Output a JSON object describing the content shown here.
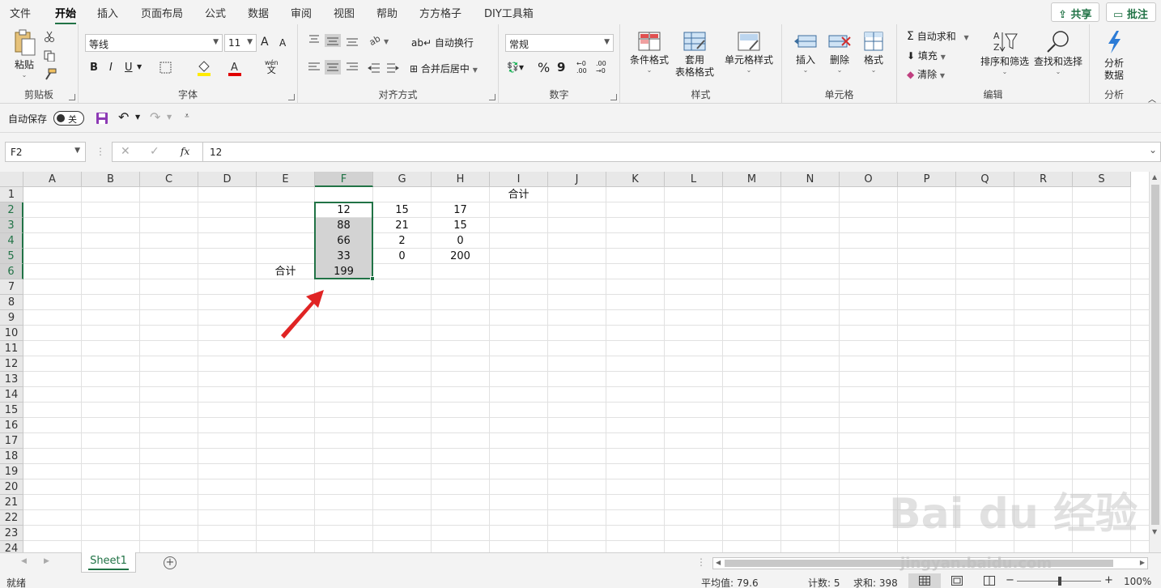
{
  "menu": {
    "tabs": [
      "文件",
      "开始",
      "插入",
      "页面布局",
      "公式",
      "数据",
      "审阅",
      "视图",
      "帮助",
      "方方格子",
      "DIY工具箱"
    ],
    "share": "共享",
    "comment": "批注"
  },
  "ribbon": {
    "clipboard": {
      "label": "剪贴板",
      "paste": "粘贴"
    },
    "font": {
      "label": "字体",
      "name": "等线",
      "size": "11",
      "grow": "A",
      "shrink": "A",
      "bold": "B",
      "italic": "I",
      "underline": "U",
      "phonetic_top": "wén",
      "phonetic_bottom": "文"
    },
    "align": {
      "label": "对齐方式",
      "wrap": "自动换行",
      "merge": "合并后居中"
    },
    "number": {
      "label": "数字",
      "format": "常规",
      "percent": "%",
      "comma": "9",
      "inc": "←0 .00",
      "dec": ".00 →0"
    },
    "styles": {
      "label": "样式",
      "conditional": "条件格式",
      "table_line1": "套用",
      "table_line2": "表格格式",
      "cell_styles": "单元格样式"
    },
    "cells": {
      "label": "单元格",
      "insert": "插入",
      "delete": "删除",
      "format": "格式"
    },
    "edit": {
      "label": "编辑",
      "autosum": "自动求和",
      "fill": "填充",
      "clear": "清除",
      "sort": "排序和筛选",
      "find": "查找和选择"
    },
    "analysis": {
      "label": "分析",
      "btn_line1": "分析",
      "btn_line2": "数据"
    }
  },
  "qat": {
    "autosave": "自动保存",
    "toggle": "关"
  },
  "formula_bar": {
    "name_box": "F2",
    "fx": "fx",
    "value": "12"
  },
  "sheet": {
    "columns": [
      "A",
      "B",
      "C",
      "D",
      "E",
      "F",
      "G",
      "H",
      "I",
      "J",
      "K",
      "L",
      "M",
      "N",
      "O",
      "P",
      "Q",
      "R",
      "S"
    ],
    "rows": [
      "1",
      "2",
      "3",
      "4",
      "5",
      "6",
      "7",
      "8",
      "9",
      "10",
      "11",
      "12",
      "13",
      "14",
      "15",
      "16",
      "17",
      "18",
      "19",
      "20",
      "21",
      "22",
      "23",
      "24"
    ],
    "cells": {
      "I1": "合计",
      "F2": "12",
      "G2": "15",
      "H2": "17",
      "F3": "88",
      "G3": "21",
      "H3": "15",
      "F4": "66",
      "G4": "2",
      "H4": "0",
      "F5": "33",
      "G5": "0",
      "H5": "200",
      "E6": "合计",
      "F6": "199"
    },
    "selected_column": "F",
    "selected_rows": [
      "2",
      "3",
      "4",
      "5",
      "6"
    ]
  },
  "tabs": {
    "sheet": "Sheet1",
    "add": "+"
  },
  "status": {
    "ready": "就绪",
    "average": "平均值: 79.6",
    "count": "计数: 5",
    "sum": "求和: 398",
    "zoom": "100%"
  },
  "watermark": {
    "logo": "Bai du 经验",
    "url": "jingyan.baidu.com"
  },
  "colors": {
    "accent": "#217346",
    "arrow": "#e02424"
  }
}
